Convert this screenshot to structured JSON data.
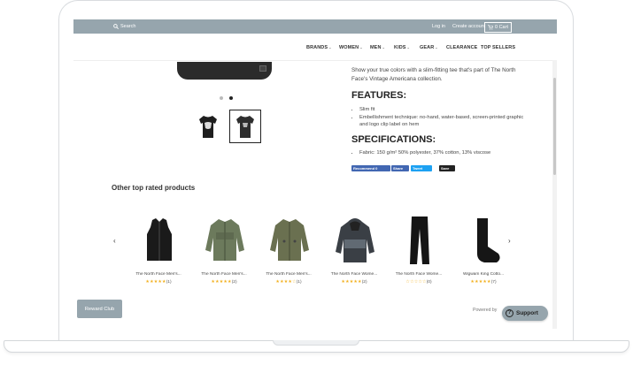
{
  "topbar": {
    "search_label": "Search",
    "login_label": "Log in",
    "create_account_label": "Create account",
    "cart_label": "0 Cart"
  },
  "nav": {
    "items": [
      {
        "label": "BRANDS",
        "dropdown": true
      },
      {
        "label": "WOMEN",
        "dropdown": true
      },
      {
        "label": "MEN",
        "dropdown": true
      },
      {
        "label": "KIDS",
        "dropdown": true
      },
      {
        "label": "GEAR",
        "dropdown": true
      },
      {
        "label": "CLEARANCE",
        "dropdown": false
      },
      {
        "label": "TOP SELLERS",
        "dropdown": false
      }
    ],
    "chevron": "⌄"
  },
  "product": {
    "description": "Show your true colors with a slim-fitting tee that's part of The North Face's Vintage Americana collection.",
    "features_heading": "FEATURES:",
    "features": [
      "Slim fit",
      "Embellishment technique: no-hand, water-based, screen-printed graphic and logo clip label on hem"
    ],
    "specifications_heading": "SPECIFICATIONS:",
    "specifications": [
      "Fabric: 150 g/m² 50% polyester, 37% cotton, 13% viscose"
    ],
    "share_buttons": {
      "facebook": "Recommend 0",
      "share": "Share",
      "tweet": "Tweet",
      "save": "Save"
    }
  },
  "related": {
    "title": "Other top rated products",
    "prev_arrow": "‹",
    "next_arrow": "›",
    "items": [
      {
        "name": "The North Face Men's...",
        "stars": "★★★★★",
        "count": "(1)",
        "icon": "vest-icon"
      },
      {
        "name": "The North Face Men's...",
        "stars": "★★★★★",
        "count": "(2)",
        "icon": "jacket-icon"
      },
      {
        "name": "The North Face Men's...",
        "stars": "★★★★☆",
        "count": "(1)",
        "icon": "jacket-icon"
      },
      {
        "name": "The North Face Wome...",
        "stars": "★★★★★",
        "count": "(2)",
        "icon": "hooded-jacket-icon"
      },
      {
        "name": "The North Face Wome...",
        "stars": "☆☆☆☆☆",
        "count": "(0)",
        "icon": "pants-icon"
      },
      {
        "name": "Wigwam King Cotto...",
        "stars": "★★★★★",
        "count": "(7)",
        "icon": "sock-icon"
      }
    ]
  },
  "footer": {
    "reward_label": "Reward Club",
    "powered_by": "Powered by",
    "support_label": "Support",
    "support_icon": "?"
  },
  "colors": {
    "accent": "#96a5ad",
    "star": "#f2b01e"
  }
}
